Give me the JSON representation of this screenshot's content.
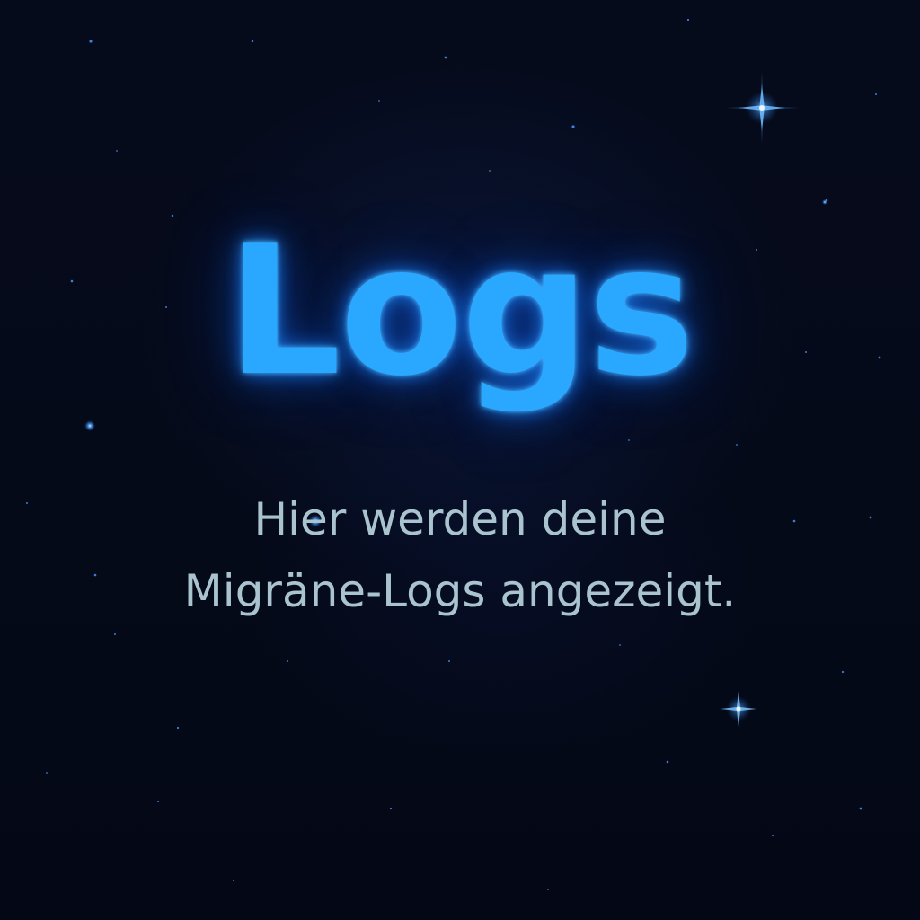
{
  "screen": {
    "title": "Logs",
    "message_line_1": "Hier werden deine",
    "message_line_2": "Migräne-Logs angezeigt."
  },
  "theme": {
    "background": "#050a1a",
    "title_color": "#2aa8ff",
    "text_color": "#a9c3cf",
    "star_color": "#4aa6ff"
  }
}
